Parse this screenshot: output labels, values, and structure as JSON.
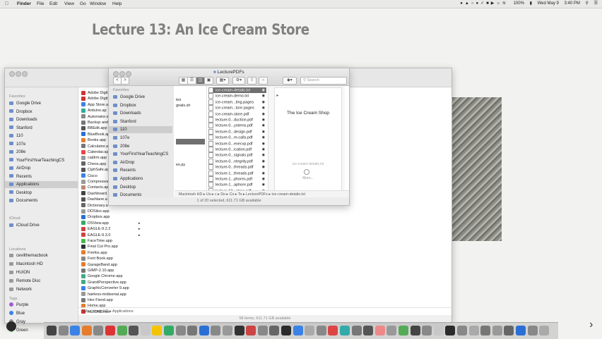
{
  "menubar": {
    "items": [
      "Finder",
      "File",
      "Edit",
      "View",
      "Go",
      "Window",
      "Help"
    ],
    "status": [
      "100%",
      "Wed May 9",
      "3:40 PM"
    ]
  },
  "slide": {
    "title": "Lecture 13: An Ice Cream Store"
  },
  "big_finder": {
    "sidebar": {
      "favorites_header": "Favorites",
      "favorites": [
        "Google Drive",
        "Dropbox",
        "Downloads",
        "Stanford",
        "110",
        "107e",
        "208e",
        "YourFirstYearTeachingCS",
        "AirDrop",
        "Recents",
        "Applications",
        "Desktop",
        "Documents"
      ],
      "icloud_header": "iCloud",
      "icloud": [
        "iCloud Drive"
      ],
      "locations_header": "Locations",
      "locations": [
        "cevilthemacbook",
        "Macintosh HD",
        "HUION",
        "Remote Disc",
        "Network"
      ],
      "tags_header": "Tags",
      "tags": [
        {
          "label": "Purple",
          "color": "#a35bd0"
        },
        {
          "label": "Blue",
          "color": "#3b82e6"
        },
        {
          "label": "Gray",
          "color": "#8e8e8e"
        },
        {
          "label": "Green",
          "color": "#4cb84a"
        }
      ]
    },
    "apps": [
      "Adobe Digit",
      "Adobe Digit",
      "App Store.a",
      "Arduino.ap",
      "Automator.a",
      "Backup and",
      "BBEdit.app",
      "BlueBook.ap",
      "Books.app",
      "Calculator.a",
      "Calendar.ap",
      "caldrm.app",
      "Chess.app",
      "CiphSafe.ap",
      "Cisco",
      "Compressor",
      "Contacts.ap",
      "Dashboard.",
      "Dashlane.a",
      "Dictionary.a",
      "DDSilox.app",
      "Dropbox.app",
      "DSView.app",
      "EAGLE-9.2.2",
      "EAGLE-9.3.0",
      "FaceTime.app",
      "Final Cut Pro.app",
      "Firefox.app",
      "Font Book.app",
      "GarageBand.app",
      "GIMP-2.10.app",
      "Google Chrome.app",
      "GrandPerspective.app",
      "GraphicConverter 9.app",
      "hairless-midiserial.app",
      "Hex Fiend.app",
      "Home.app",
      "HUIONDriver"
    ],
    "path": "Macintosh HD ▸ Applications",
    "status": "58 items, 611.71 GB available"
  },
  "small_finder": {
    "title": "LecturePDFs",
    "search_placeholder": "Search",
    "nav": {
      "back": "<",
      "forward": ">"
    },
    "sidebar_header": "Favorites",
    "sidebar": [
      "Google Drive",
      "Dropbox",
      "Downloads",
      "Stanford",
      "110",
      "107e",
      "208e",
      "YourFirstYearTeachingCS",
      "AirDrop",
      "Recents",
      "Applications",
      "Desktop",
      "Documents"
    ],
    "col1": [
      "tes",
      "gnals.sh",
      "",
      "",
      "",
      "",
      "",
      "",
      "",
      "",
      "",
      "es.py"
    ],
    "files": [
      "ice-cream-details.txt",
      "ice-cream-demo.txt",
      "ice-cream...ting.pages",
      "ice-cream...tore.pages",
      "ice-cream-store.pdf",
      "lecture-0...duction.pdf",
      "lecture-0...ystems.pdf",
      "lecture-0...design.pdf",
      "lecture-0...m-calls.pdf",
      "lecture-0...execvp.pdf",
      "lecture-0...ication.pdf",
      "lecture-0...signals.pdf",
      "lecture-0...ntegrity.pdf",
      "lecture-0...threads.pdf",
      "lecture-1...threads.pdf",
      "lecture-1...phores.pdf",
      "lecture-1...aphore.pdf",
      "lecture-13...store.pdf"
    ],
    "selected_index": 0,
    "preview": {
      "heading": "The Ice Cream Shop",
      "caption": "ice-cream-details.txt",
      "more": "More..."
    },
    "path": "Macintosh HD ▸ Us ▸ c ▸ Do ▸ Co ▸ To ▸ LecturePDFs ▸ ice-cream-details.txt",
    "status": "1 of 20 selected, 611.71 GB available"
  },
  "dock": {
    "colors": [
      "#444",
      "#888",
      "#3b82e6",
      "#e67c2e",
      "#888",
      "#d33",
      "#5a5",
      "#555",
      "#c8c8c8",
      "#f5c400",
      "#3a6",
      "#888",
      "#777",
      "#2a6fd6",
      "#888",
      "#999",
      "#333",
      "#c44",
      "#888",
      "#666",
      "#2b2b2b",
      "#3b82e6",
      "#aaa",
      "#888",
      "#d44",
      "#3aa",
      "#777",
      "#555",
      "#e88",
      "#999",
      "#5a5",
      "#444",
      "#888",
      "#c8c8c8",
      "#2b2b2b",
      "#888",
      "#aaa",
      "#777",
      "#999",
      "#666",
      "#2a6fd6",
      "#888",
      "#aaa"
    ]
  },
  "slide_nav": {
    "next": "›"
  }
}
